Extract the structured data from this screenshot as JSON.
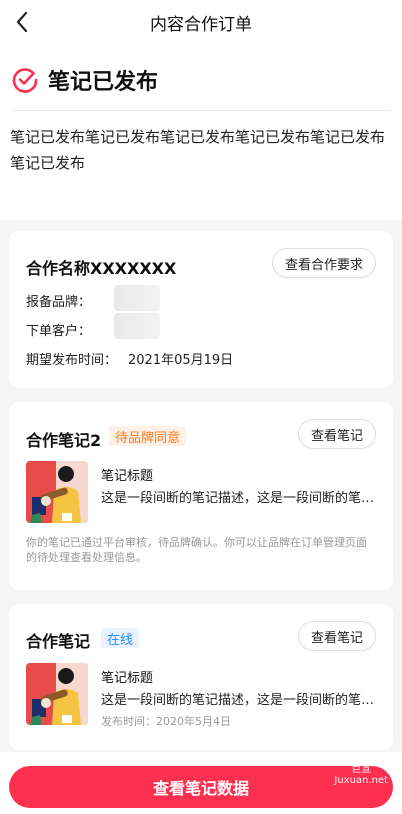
{
  "header": {
    "title": "内容合作订单",
    "back_icon": "chevron-left-icon"
  },
  "status": {
    "title": "笔记已发布",
    "description": "笔记已发布笔记已发布笔记已发布笔记已发布笔记已发布笔记已发布",
    "icon": "check-circle-icon",
    "accent_color": "#ff2f4f"
  },
  "cooperation": {
    "name": "合作名称XXXXXXX",
    "requirements_button": "查看合作要求",
    "brand_label": "报备品牌：",
    "customer_label": "下单客户：",
    "publish_time_label": "期望发布时间：",
    "publish_time_value": "2021年05月19日"
  },
  "notes": [
    {
      "title": "合作笔记2",
      "tag": "待品牌同意",
      "view_button": "查看笔记",
      "note_title": "笔记标题",
      "note_desc": "这是一段间断的笔记描述，这是一段间断的笔记描述",
      "hint": "你的笔记已通过平台审核，待品牌确认。你可以让品牌在订单管理页面的待处理查看处理信息。"
    },
    {
      "title": "合作笔记",
      "tag": "在线",
      "view_button": "查看笔记",
      "note_title": "笔记标题",
      "note_desc": "这是一段间断的笔记描述，这是一段间断的笔记描述",
      "publish_time": "发布时间：2020年5月4日"
    }
  ],
  "bottom": {
    "primary_button": "查看笔记数据"
  },
  "watermark": {
    "line1": "巨宣",
    "line2": "Juxuan.net"
  }
}
